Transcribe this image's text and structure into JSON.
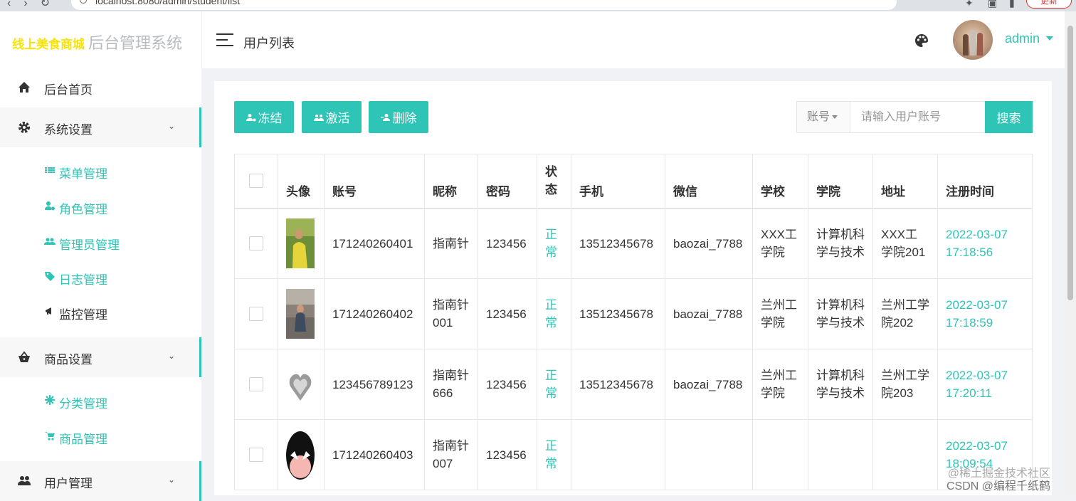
{
  "browser": {
    "url": "localhost:8080/admin/student/list",
    "update_label": "更新"
  },
  "logo": {
    "brand": "线上美食商城",
    "system": "后台管理系统"
  },
  "sidebar": {
    "items": [
      {
        "label": "后台首页",
        "icon": "home-icon"
      },
      {
        "label": "系统设置",
        "icon": "gear-icon",
        "expanded": true
      },
      {
        "label": "商品设置",
        "icon": "basket-icon",
        "expanded": true
      },
      {
        "label": "用户管理",
        "icon": "users-icon",
        "expanded": true
      }
    ],
    "system_sub": [
      {
        "label": "菜单管理",
        "icon": "list-icon"
      },
      {
        "label": "角色管理",
        "icon": "user-gear-icon"
      },
      {
        "label": "管理员管理",
        "icon": "users-icon"
      },
      {
        "label": "日志管理",
        "icon": "tag-icon"
      },
      {
        "label": "监控管理",
        "icon": "bullhorn-icon"
      }
    ],
    "goods_sub": [
      {
        "label": "分类管理",
        "icon": "asterisk-icon"
      },
      {
        "label": "商品管理",
        "icon": "cart-icon"
      }
    ]
  },
  "topbar": {
    "page_title": "用户列表",
    "username": "admin"
  },
  "toolbar": {
    "freeze_label": "冻结",
    "activate_label": "激活",
    "delete_label": "删除",
    "search_select_label": "账号",
    "search_placeholder": "请输入用户账号",
    "search_button_label": "搜索"
  },
  "table": {
    "headers": [
      "",
      "头像",
      "账号",
      "昵称",
      "密码",
      "状态",
      "手机",
      "微信",
      "学校",
      "学院",
      "地址",
      "注册时间"
    ],
    "rows": [
      {
        "account": "171240260401",
        "nickname": "指南针",
        "password": "123456",
        "status": "正常",
        "phone": "13512345678",
        "wechat": "baozai_7788",
        "school": "XXX工学院",
        "college": "计算机科学与技术",
        "address": "XXX工学院201",
        "registered": "2022-03-07 17:18:56"
      },
      {
        "account": "171240260402",
        "nickname": "指南针001",
        "password": "123456",
        "status": "正常",
        "phone": "13512345678",
        "wechat": "baozai_7788",
        "school": "兰州工学院",
        "college": "计算机科学与技术",
        "address": "兰州工学院202",
        "registered": "2022-03-07 17:18:59"
      },
      {
        "account": "123456789123",
        "nickname": "指南针666",
        "password": "123456",
        "status": "正常",
        "phone": "13512345678",
        "wechat": "baozai_7788",
        "school": "兰州工学院",
        "college": "计算机科学与技术",
        "address": "兰州工学院203",
        "registered": "2022-03-07 17:20:11"
      },
      {
        "account": "171240260403",
        "nickname": "指南针007",
        "password": "123456",
        "status": "正常",
        "phone": "",
        "wechat": "",
        "school": "",
        "college": "",
        "address": "",
        "registered": "2022-03-07 18:09:54"
      }
    ]
  },
  "watermark": {
    "line1": "@稀土掘金技术社区",
    "line2": "CSDN @编程千纸鹤"
  },
  "colors": {
    "accent": "#2ec4b6",
    "brand_yellow": "#f5e30a"
  }
}
